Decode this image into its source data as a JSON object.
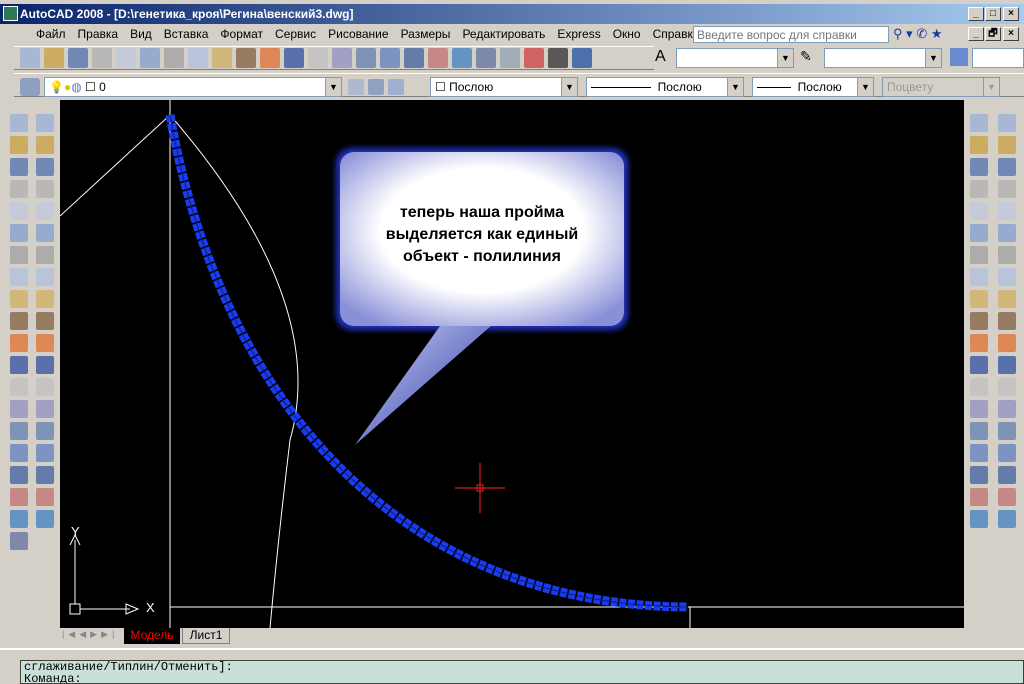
{
  "window": {
    "title": "AutoCAD 2008 - [D:\\генетика_кроя\\Регина\\венский3.dwg]",
    "min": "_",
    "max": "□",
    "close": "×",
    "restore": "🗗"
  },
  "menu": [
    "Файл",
    "Правка",
    "Вид",
    "Вставка",
    "Формат",
    "Сервис",
    "Рисование",
    "Размеры",
    "Редактировать",
    "Express",
    "Окно",
    "Справка"
  ],
  "help": {
    "placeholder": "Введите вопрос для справки"
  },
  "standard_toolbar": [
    "new-icon",
    "open-icon",
    "save-icon",
    "print-icon",
    "preview-icon",
    "publish-icon",
    "cut-icon",
    "copy-icon",
    "paste-icon",
    "match-properties-icon",
    "block-editor-icon",
    "undo-icon",
    "redo-icon",
    "pan-icon",
    "zoom-realtime-icon",
    "zoom-window-icon",
    "zoom-previous-icon",
    "properties-icon",
    "design-center-icon",
    "tool-palettes-icon",
    "sheet-set-icon",
    "markup-icon",
    "calculator-icon",
    "help-icon"
  ],
  "layers": {
    "current": "0",
    "color": "Послою",
    "linetype": "Послою",
    "lineweight": "Послою",
    "plotstyle": "Поцвету"
  },
  "draw_toolbar": [
    "line-icon",
    "construction-line-icon",
    "polyline-icon",
    "polygon-icon",
    "rectangle-icon",
    "arc-icon",
    "circle-icon",
    "revision-cloud-icon",
    "spline-icon",
    "ellipse-icon",
    "ellipse-arc-icon",
    "insert-block-icon",
    "make-block-icon",
    "point-icon",
    "hatch-icon",
    "gradient-icon",
    "region-icon",
    "table-icon",
    "mtext-icon"
  ],
  "modify_toolbar": [
    "erase-icon",
    "copy-object-icon",
    "mirror-icon",
    "offset-icon",
    "array-icon",
    "move-icon",
    "rotate-icon",
    "scale-icon",
    "stretch-icon",
    "trim-icon",
    "extend-icon",
    "break-at-point-icon",
    "break-icon",
    "join-icon",
    "chamfer-icon",
    "fillet-icon",
    "explode-icon",
    "pedit-icon",
    "pline-join-icon",
    "explode2-icon"
  ],
  "dim_toolbar": [
    "linear-dim-icon",
    "aligned-dim-icon",
    "arc-length-icon",
    "ordinate-icon",
    "radius-icon",
    "jogged-icon",
    "diameter-icon",
    "angular-icon",
    "quick-dim-icon",
    "baseline-icon",
    "continue-icon",
    "tolerance-icon",
    "center-mark-icon",
    "inspection-icon",
    "dimtext-icon",
    "dimedit-icon",
    "dimstyle-icon",
    "dim-update-icon",
    "dim-override-icon"
  ],
  "callout": {
    "lines": [
      "теперь наша пройма",
      "выделяется как единый",
      "объект - полилиния"
    ]
  },
  "ucs": {
    "x": "X",
    "y": "Y"
  },
  "tabs": {
    "model": "Модель",
    "layout1": "Лист1"
  },
  "command": {
    "line1": "сглаживание/Типлин/Отменить]:",
    "line2": "Команда:"
  },
  "colors": {
    "selection": "#1a3cf0",
    "crosshair": "#ff2020",
    "model_tab": "#ff0000"
  }
}
